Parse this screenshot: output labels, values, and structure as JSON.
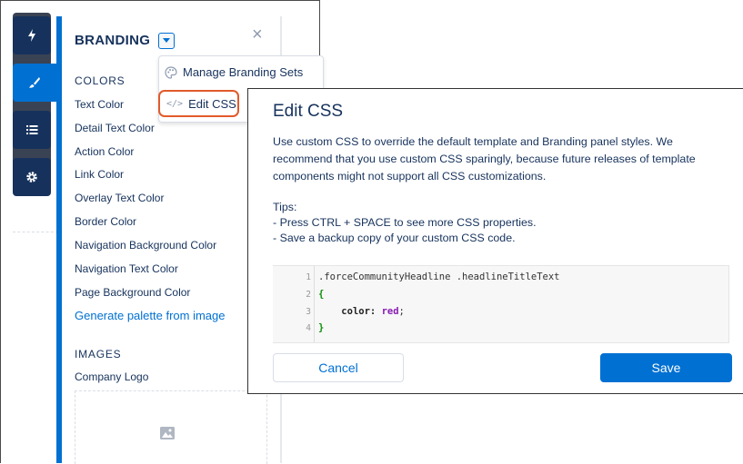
{
  "panel": {
    "title": "BRANDING",
    "colors_heading": "COLORS",
    "color_props": [
      "Text Color",
      "Detail Text Color",
      "Action Color",
      "Link Color",
      "Overlay Text Color",
      "Border Color",
      "Navigation Background Color",
      "Navigation Text Color",
      "Page Background Color"
    ],
    "generate_link": "Generate palette from image",
    "images_heading": "IMAGES",
    "company_logo": "Company Logo"
  },
  "menu": {
    "items": [
      "Manage Branding Sets",
      "Edit CSS"
    ]
  },
  "modal": {
    "title": "Edit CSS",
    "description": "Use custom CSS to override the default template and Branding panel styles. We recommend that you use custom CSS sparingly, because future releases of template components might not support all CSS customizations.",
    "tips_heading": "Tips:",
    "tips": [
      "- Press CTRL + SPACE to see more CSS properties.",
      "- Save a backup copy of your custom CSS code."
    ],
    "code": {
      "line_numbers": [
        "1",
        "2",
        "3",
        "4"
      ],
      "selector": ".forceCommunityHeadline .headlineTitleText",
      "open_brace": "{",
      "property": "color",
      "value": "red",
      "close_brace": "}"
    },
    "cancel_label": "Cancel",
    "save_label": "Save"
  },
  "colors": {
    "accent": "#0070d2",
    "text": "#16325c",
    "rail_dark": "#16325c",
    "highlight": "#e15a2b"
  }
}
